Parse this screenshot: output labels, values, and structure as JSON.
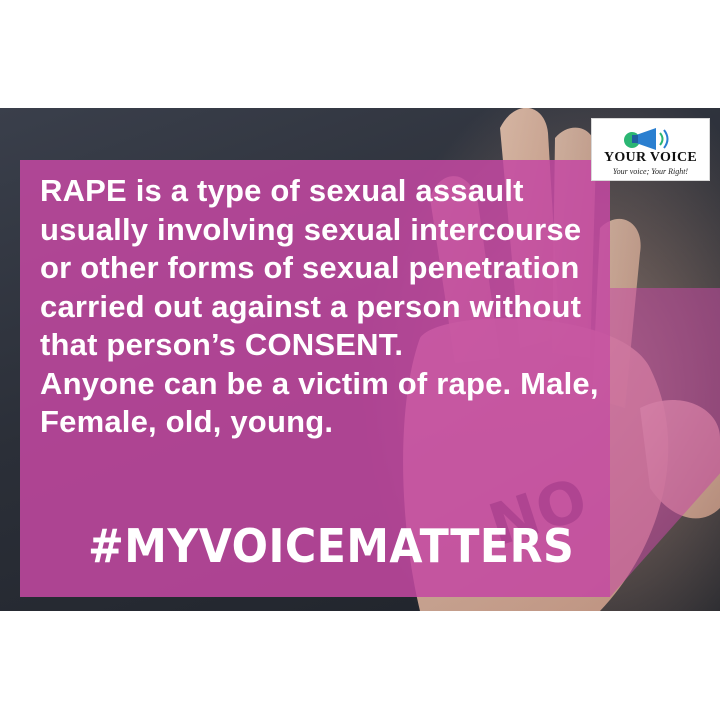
{
  "poster": {
    "body_lines": [
      "RAPE is a type of sexual assault",
      "usually involving sexual intercourse",
      "or other forms of sexual penetration",
      "carried out against a person without",
      "that person’s CONSENT.",
      "Anyone can be a victim of rape. Male,",
      "Female, old, young."
    ],
    "hashtag": "#MYVOICEMATTERS",
    "palm_text": "NO",
    "colors": {
      "panel": "#c448a2",
      "text": "#ffffff",
      "background": "#2b2f38"
    }
  },
  "logo": {
    "title": "YOUR VOICE",
    "tagline": "Your voice; Your Right!",
    "icon": "megaphone-icon",
    "colors": {
      "megaphone": "#2a7fd0",
      "accent": "#2bb673"
    }
  }
}
